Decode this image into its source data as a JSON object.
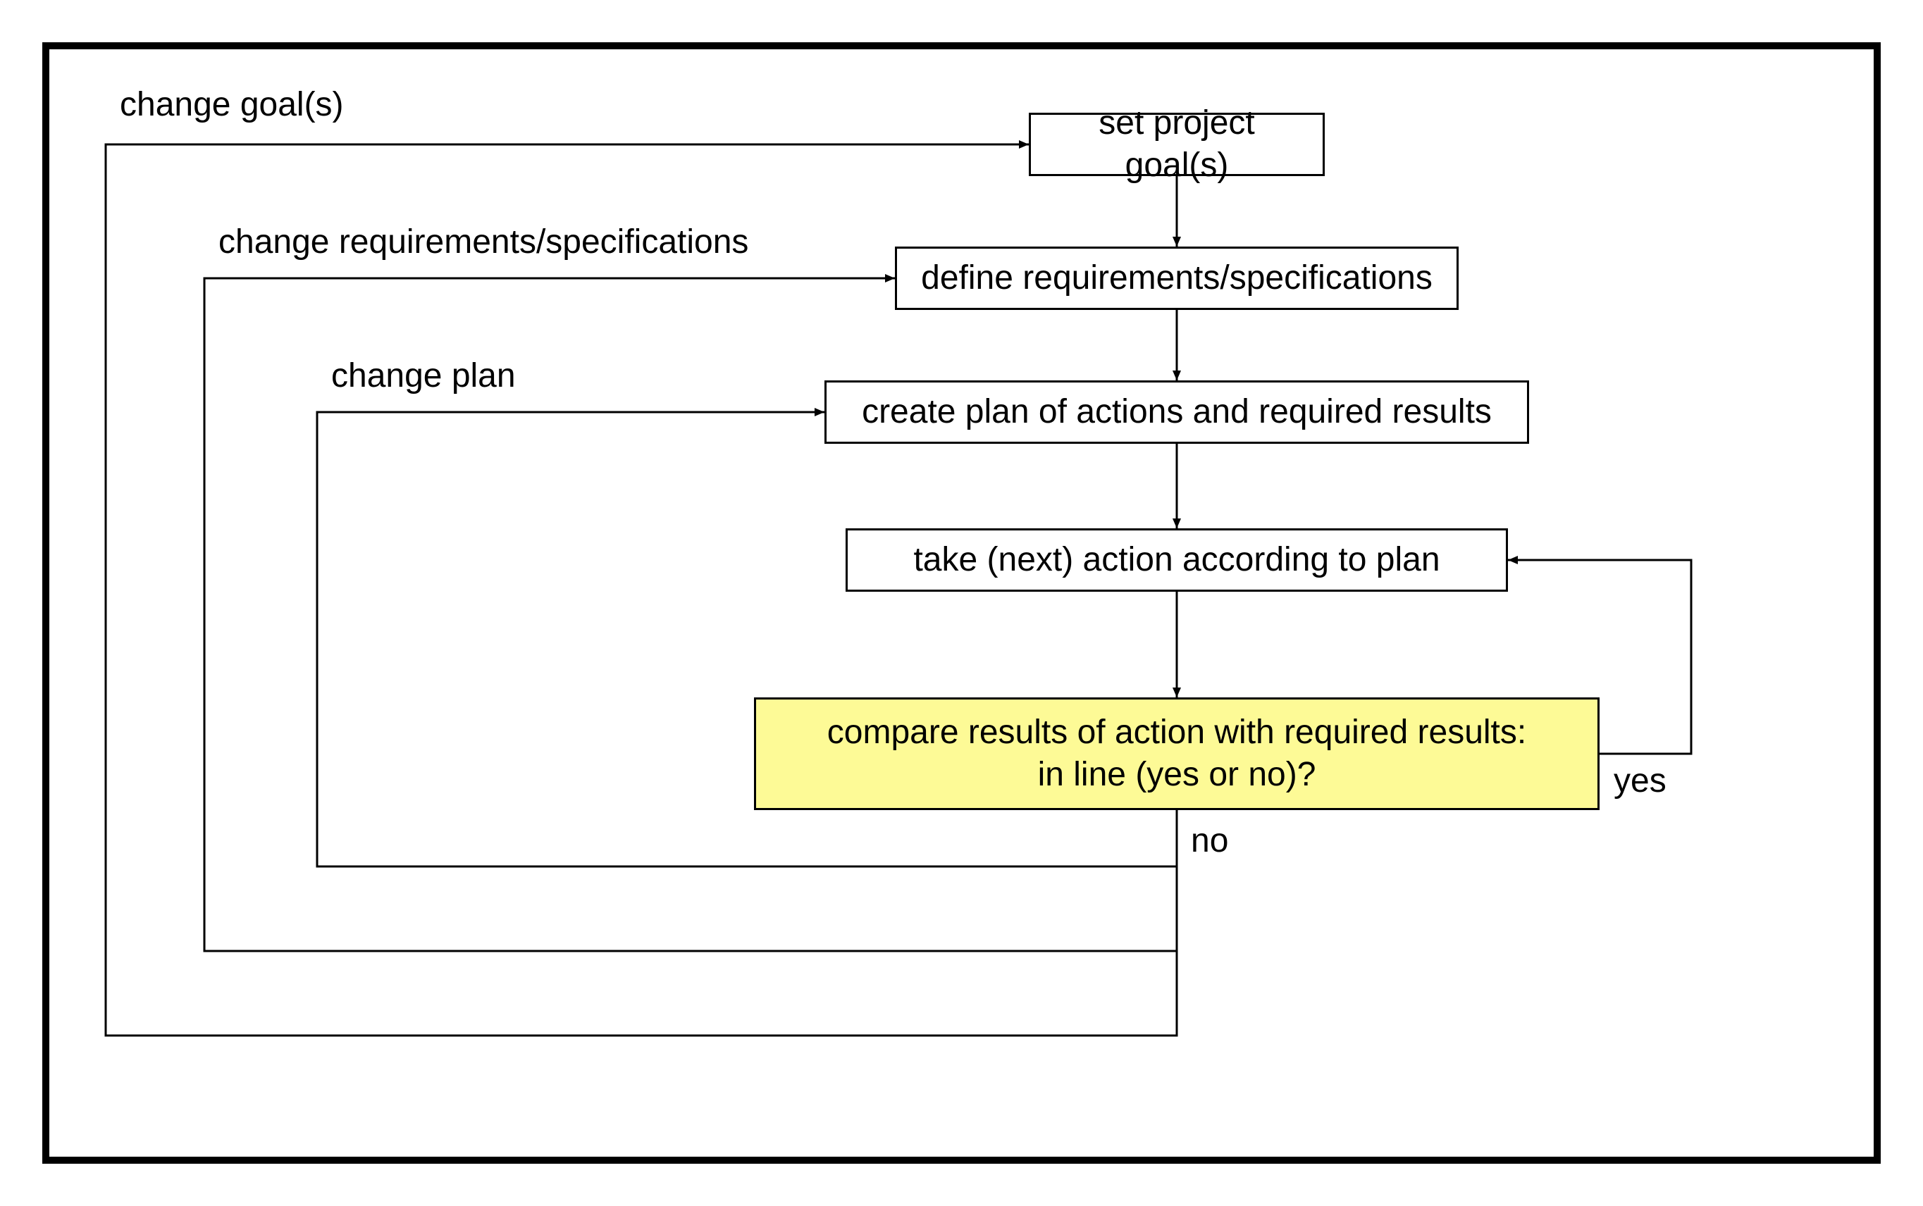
{
  "diagram": {
    "type": "flowchart",
    "nodes": {
      "set_goal": {
        "text": "set project goal(s)"
      },
      "define_req": {
        "text": "define requirements/specifications"
      },
      "create_plan": {
        "text": "create plan of actions and required results"
      },
      "take_action": {
        "text": "take (next) action according to plan"
      },
      "compare": {
        "text": "compare results of action with required results:\nin line (yes or no)?",
        "highlight": true
      }
    },
    "edges": {
      "change_goal": {
        "label": "change goal(s)"
      },
      "change_req": {
        "label": "change requirements/specifications"
      },
      "change_plan": {
        "label": "change plan"
      },
      "yes": {
        "label": "yes"
      },
      "no": {
        "label": "no"
      }
    }
  }
}
